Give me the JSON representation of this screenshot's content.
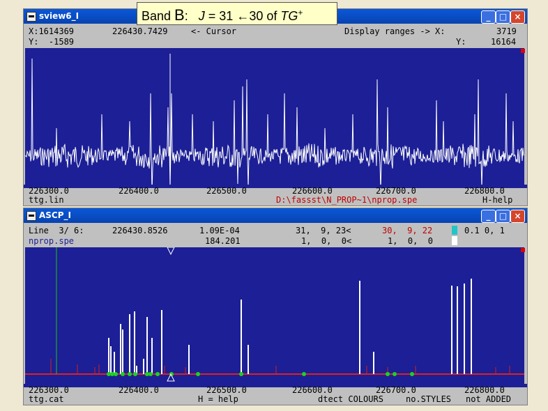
{
  "overlay": {
    "band_prefix": "Band ",
    "band_letter": "B",
    "band_colon": ":",
    "j_sym": "J",
    "j_expr": " = 31 ",
    "arrow": "←",
    "j_expr2": "30 of ",
    "tg": "TG",
    "tg_sup": "+"
  },
  "win1": {
    "title": "sview6_I",
    "buttons": {
      "minimize": "_",
      "maximize": "□",
      "close": "×"
    },
    "cursor_x": "X:1614369",
    "cursor_y": "Y:  -1589",
    "cursor_freq": "226430.7429",
    "cursor_label": "<- Cursor",
    "display_ranges": "Display ranges -> X:",
    "range_x": "3719",
    "range_y_label": "Y:",
    "range_y": "16164",
    "axis_ticks": [
      "226300.0",
      "226400.0",
      "226500.0",
      "226600.0",
      "226700.0",
      "226800.0"
    ],
    "file_left": "ttg.lin",
    "file_path": "D:\\fassst\\N_PROP~1\\nprop.spe",
    "help": "H-help"
  },
  "win2": {
    "title": "ASCP_I",
    "buttons": {
      "minimize": "_",
      "maximize": "□",
      "close": "×"
    },
    "line_label": "Line  3/ 6:",
    "line_freq": "226430.8526",
    "line_val1": "1.09E-04",
    "line_val2": "184.201",
    "qn_upper": "31,  9, 23<",
    "qn_lower": "1,  0,  0<",
    "qn_upper2": "30,  9, 22",
    "qn_lower2": "1,  0,  0",
    "extra": "0.1 0, 1",
    "file_name": "nprop.spe",
    "axis_ticks": [
      "226300.0",
      "226400.0",
      "226500.0",
      "226600.0",
      "226700.0",
      "226800.0"
    ],
    "file_left": "ttg.cat",
    "help": "H = help",
    "opt1": "dtect COLOURS",
    "opt2": "no.STYLES",
    "opt3": "not ADDED"
  }
}
